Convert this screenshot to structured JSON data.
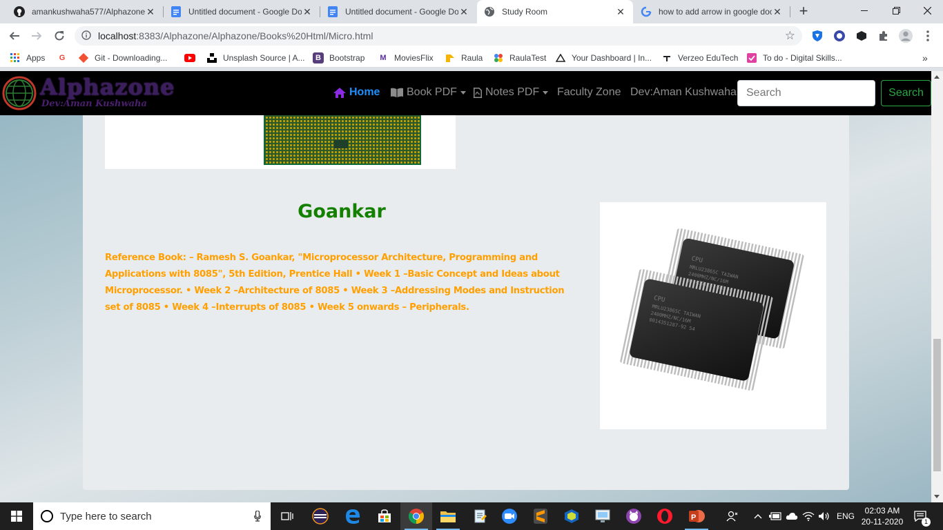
{
  "browser": {
    "tabs": [
      {
        "title": "amankushwaha577/Alphazone",
        "icon": "github-icon"
      },
      {
        "title": "Untitled document - Google Docs",
        "icon": "google-docs-icon"
      },
      {
        "title": "Untitled document - Google Docs",
        "icon": "google-docs-icon"
      },
      {
        "title": "Study Room",
        "icon": "globe-icon"
      },
      {
        "title": "how to add arrow in google docs",
        "icon": "google-icon"
      }
    ],
    "active_tab": 3,
    "url_host": "localhost",
    "url_rest": ":8383/Alphazone/Alphazone/Books%20Html/Micro.html",
    "bookmarks": [
      {
        "label": "Apps",
        "icon": "apps-grid-icon"
      },
      {
        "label": "",
        "icon": "google-icon"
      },
      {
        "label": "Git - Downloading...",
        "icon": "git-icon"
      },
      {
        "label": "",
        "icon": "youtube-icon"
      },
      {
        "label": "Unsplash Source | A...",
        "icon": "unsplash-icon"
      },
      {
        "label": "Bootstrap",
        "icon": "bootstrap-icon"
      },
      {
        "label": "MoviesFlix",
        "icon": "moviesflix-icon"
      },
      {
        "label": "Raula",
        "icon": "raula-icon"
      },
      {
        "label": "RaulaTest",
        "icon": "raulatest-icon"
      },
      {
        "label": "Your Dashboard | In...",
        "icon": "dashboard-icon"
      },
      {
        "label": "Verzeo EduTech",
        "icon": "verzeo-icon"
      },
      {
        "label": "To do - Digital Skills...",
        "icon": "todo-icon"
      }
    ]
  },
  "site": {
    "logo_title": "Alphazone",
    "logo_subtitle": "Dev:Aman Kushwaha",
    "nav": {
      "home": "Home",
      "book_pdf": "Book PDF",
      "notes_pdf": "Notes PDF",
      "faculty": "Faculty Zone",
      "dev": "Dev:Aman Kushwaha"
    },
    "search_placeholder": "Search",
    "search_button": "Search"
  },
  "content": {
    "section_title": "Goankar",
    "reference_text": "Reference Book: – Ramesh S. Goankar, \"Microprocessor Architecture, Programming and Applications with 8085\", 5th Edition, Prentice Hall • Week 1 –Basic Concept and Ideas about Microprocessor. • Week 2 –Architecture of 8085 • Week 3 –Addressing Modes and Instruction set of 8085 • Week 4 –Interrupts of 8085 • Week 5 onwards – Peripherals.",
    "chip_label_1": "CPU",
    "chip_label_2": "MRLU23865C TAIWAN",
    "chip_label_3": "2400MHZ/NC/16M",
    "chip_label_4": "0014351287-92 54"
  },
  "taskbar": {
    "search_placeholder": "Type here to search",
    "language": "ENG",
    "time": "02:03 AM",
    "date": "20-11-2020",
    "notification_count": "1"
  },
  "colors": {
    "accent_green": "#138000",
    "text_orange": "#ffa000",
    "nav_active": "#1e90ff"
  }
}
